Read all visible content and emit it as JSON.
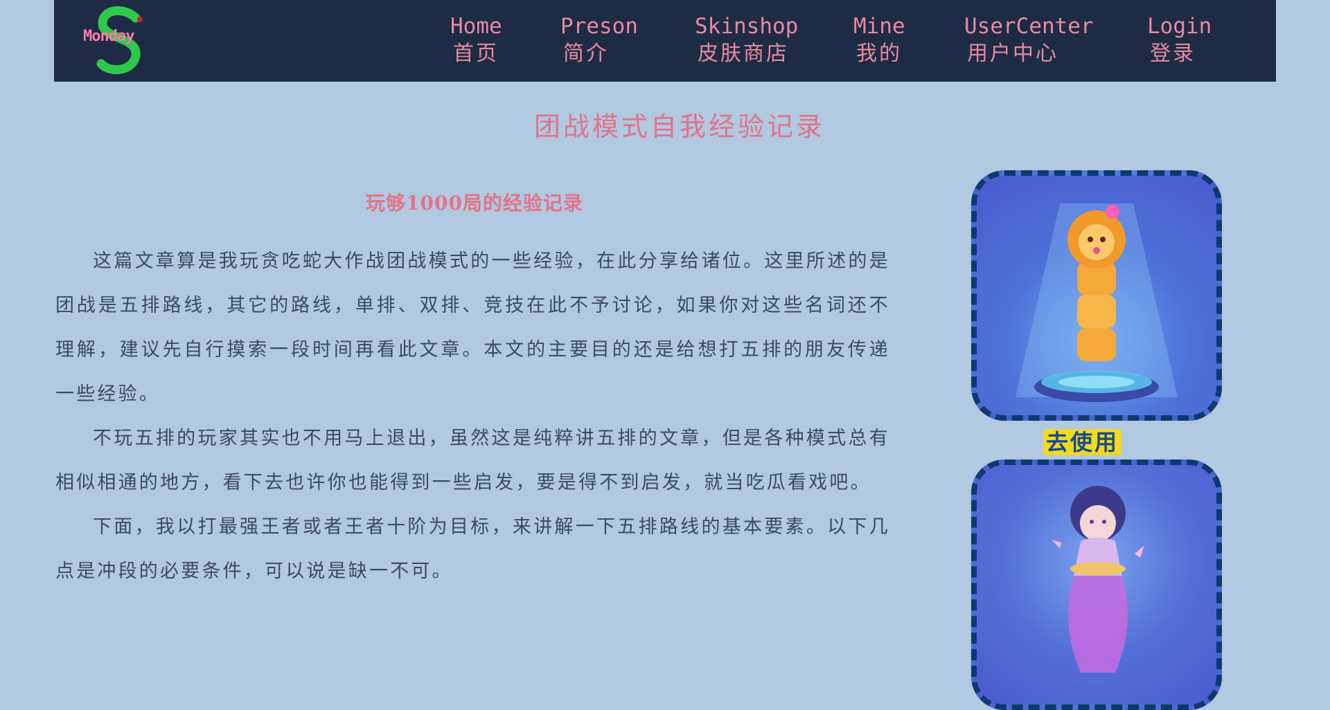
{
  "logo": {
    "text": "Monday",
    "color": "#2ec94a"
  },
  "nav": {
    "items": [
      {
        "en": "Home",
        "zh": "首页"
      },
      {
        "en": "Preson",
        "zh": "简介"
      },
      {
        "en": "Skinshop",
        "zh": "皮肤商店"
      },
      {
        "en": "Mine",
        "zh": "我的"
      },
      {
        "en": "UserCenter",
        "zh": "用户中心"
      },
      {
        "en": "Login",
        "zh": "登录"
      }
    ]
  },
  "page": {
    "title": "团战模式自我经验记录",
    "subtitle": "玩够1000局的经验记录",
    "paragraphs": [
      "这篇文章算是我玩贪吃蛇大作战团战模式的一些经验，在此分享给诸位。这里所述的是团战是五排路线，其它的路线，单排、双排、竞技在此不予讨论，如果你对这些名词还不理解，建议先自行摸索一段时间再看此文章。本文的主要目的还是给想打五排的朋友传递一些经验。",
      "不玩五排的玩家其实也不用马上退出，虽然这是纯粹讲五排的文章，但是各种模式总有相似相通的地方，看下去也许你也能得到一些启发，要是得不到启发，就当吃瓜看戏吧。",
      "下面，我以打最强王者或者王者十阶为目标，来讲解一下五排路线的基本要素。以下几点是冲段的必要条件，可以说是缺一不可。"
    ]
  },
  "sidebar": {
    "use_button": "去使用"
  },
  "colors": {
    "nav_bg": "#1d2b45",
    "accent": "#e37389",
    "page_bg": "#b1c9e1",
    "button_bg": "#f1da1e"
  }
}
